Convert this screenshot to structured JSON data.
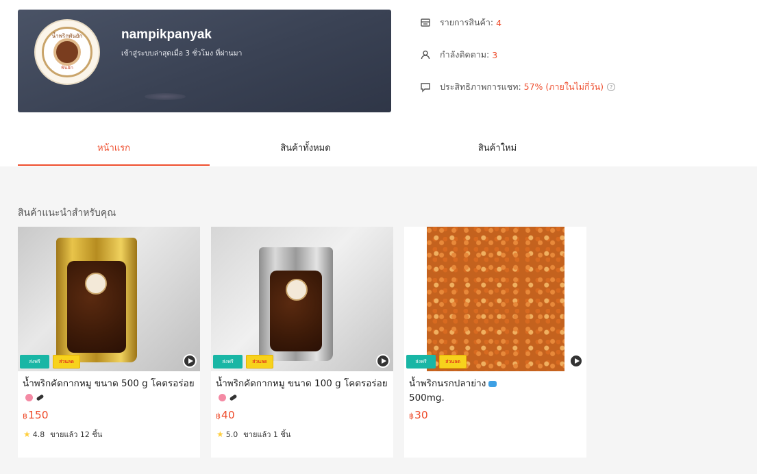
{
  "shop": {
    "name": "nampikpanyak",
    "last_login": "เข้าสู่ระบบล่าสุดเมื่อ 3 ชั่วโมง ที่ผ่านมา",
    "logo_top": "น้ำพริกพันยัก",
    "logo_bottom": "พันยัก"
  },
  "stats": [
    {
      "label": "รายการสินค้า:",
      "value": "4",
      "icon": "store-icon"
    },
    {
      "label": "กำลังติดตาม:",
      "value": "3",
      "icon": "user-icon"
    },
    {
      "label": "ประสิทธิภาพการแชท:",
      "value": "57% (ภายในไม่กี่วัน)",
      "icon": "chat-icon"
    }
  ],
  "tabs": [
    {
      "label": "หน้าแรก",
      "active": true
    },
    {
      "label": "สินค้าทั้งหมด",
      "active": false
    },
    {
      "label": "สินค้าใหม่",
      "active": false
    }
  ],
  "section_title": "สินค้าแนะนำสำหรับคุณ",
  "badges": {
    "free": "ส่งฟรี",
    "discount": "ส่วนลด"
  },
  "products": [
    {
      "name": "น้ำพริกคัดกากหมู ขนาด 500 g โคตรอร่อย",
      "currency": "฿",
      "price": "150",
      "rating": "4.8",
      "sold": "ขายแล้ว 12 ชิ้น"
    },
    {
      "name": "น้ำพริกคัดกากหมู ขนาด 100 g โคตรอร่อย",
      "currency": "฿",
      "price": "40",
      "rating": "5.0",
      "sold": "ขายแล้ว 1 ชิ้น"
    },
    {
      "name": "น้ำพริกนรกปลาย่าง",
      "name_line2": "500mg.",
      "currency": "฿",
      "price": "30"
    }
  ],
  "colors": {
    "accent": "#ee4d2d",
    "free_badge": "#19b6a5",
    "discount_badge": "#f7d21c"
  }
}
